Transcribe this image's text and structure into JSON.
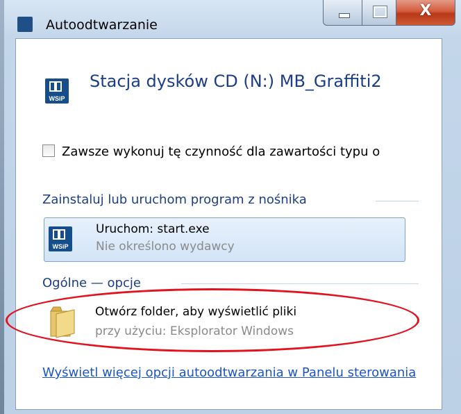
{
  "window": {
    "title": "Autoodtwarzanie",
    "close_glyph": "X"
  },
  "device": {
    "title": "Stacja dysków CD (N:) MB_Graffiti2",
    "publisher_logo_text": "WSiP"
  },
  "always_checkbox": {
    "label": "Zawsze wykonuj tę czynność dla zawartości typu o",
    "checked": false
  },
  "sections": {
    "install_header": "Zainstaluj lub uruchom program z nośnika",
    "general_header": "Ogólne — opcje"
  },
  "options": {
    "run": {
      "label": "Uruchom: start.exe",
      "sublabel": "Nie określono wydawcy",
      "icon_text": "WSiP"
    },
    "folder": {
      "label": "Otwórz folder, aby wyświetlić pliki",
      "sublabel": "przy użyciu: Eksplorator Windows",
      "icon": "folder-icon"
    }
  },
  "more_link": "Wyświetl więcej opcji autoodtwarzania w Panelu sterowania",
  "colors": {
    "heading": "#1d3e86",
    "link": "#1d55c8",
    "annotation": "#e3121f",
    "close_button": "#c84a2a"
  }
}
